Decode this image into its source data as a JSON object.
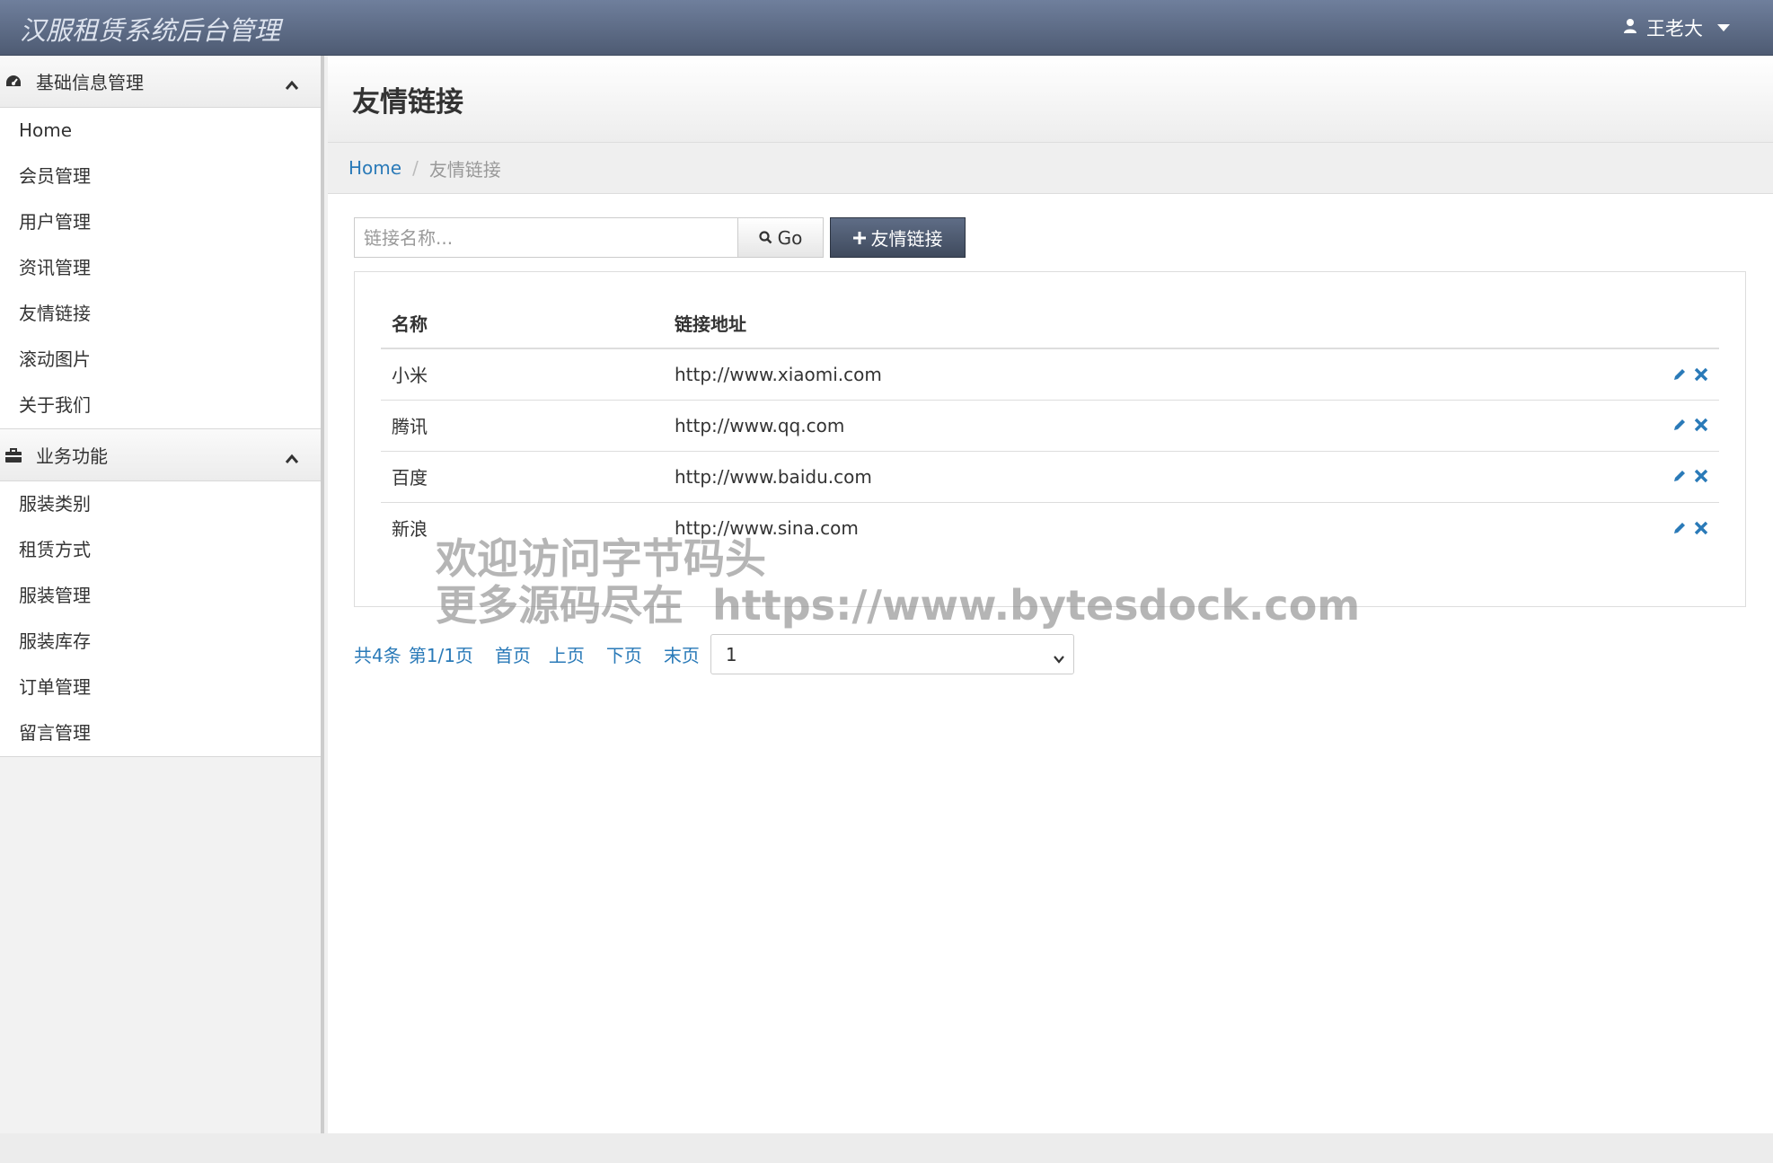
{
  "app": {
    "title": "汉服租赁系统后台管理"
  },
  "user": {
    "name": "王老大"
  },
  "sidebar": {
    "groups": [
      {
        "title": "基础信息管理",
        "items": [
          "Home",
          "会员管理",
          "用户管理",
          "资讯管理",
          "友情链接",
          "滚动图片",
          "关于我们"
        ]
      },
      {
        "title": "业务功能",
        "items": [
          "服装类别",
          "租赁方式",
          "服装管理",
          "服装库存",
          "订单管理",
          "留言管理"
        ]
      }
    ]
  },
  "page": {
    "title": "友情链接",
    "breadcrumb": {
      "home": "Home",
      "current": "友情链接"
    }
  },
  "toolbar": {
    "search_placeholder": "链接名称...",
    "go_label": "Go",
    "add_label": "友情链接"
  },
  "table": {
    "headers": [
      "名称",
      "链接地址"
    ],
    "rows": [
      {
        "name": "小米",
        "url": "http://www.xiaomi.com"
      },
      {
        "name": "腾讯",
        "url": "http://www.qq.com"
      },
      {
        "name": "百度",
        "url": "http://www.baidu.com"
      },
      {
        "name": "新浪",
        "url": "http://www.sina.com"
      }
    ]
  },
  "pager": {
    "total": "共4条",
    "page_info": "第1/1页",
    "first": "首页",
    "prev": "上页",
    "next": "下页",
    "last": "末页",
    "selected_page": "1"
  },
  "watermark": {
    "line1": "欢迎访问字节码头",
    "line2": "更多源码尽在  https://www.bytesdock.com"
  },
  "colors": {
    "navbar": "#5b6884",
    "link": "#2a7ab8",
    "primary_button": "#4a5569"
  }
}
